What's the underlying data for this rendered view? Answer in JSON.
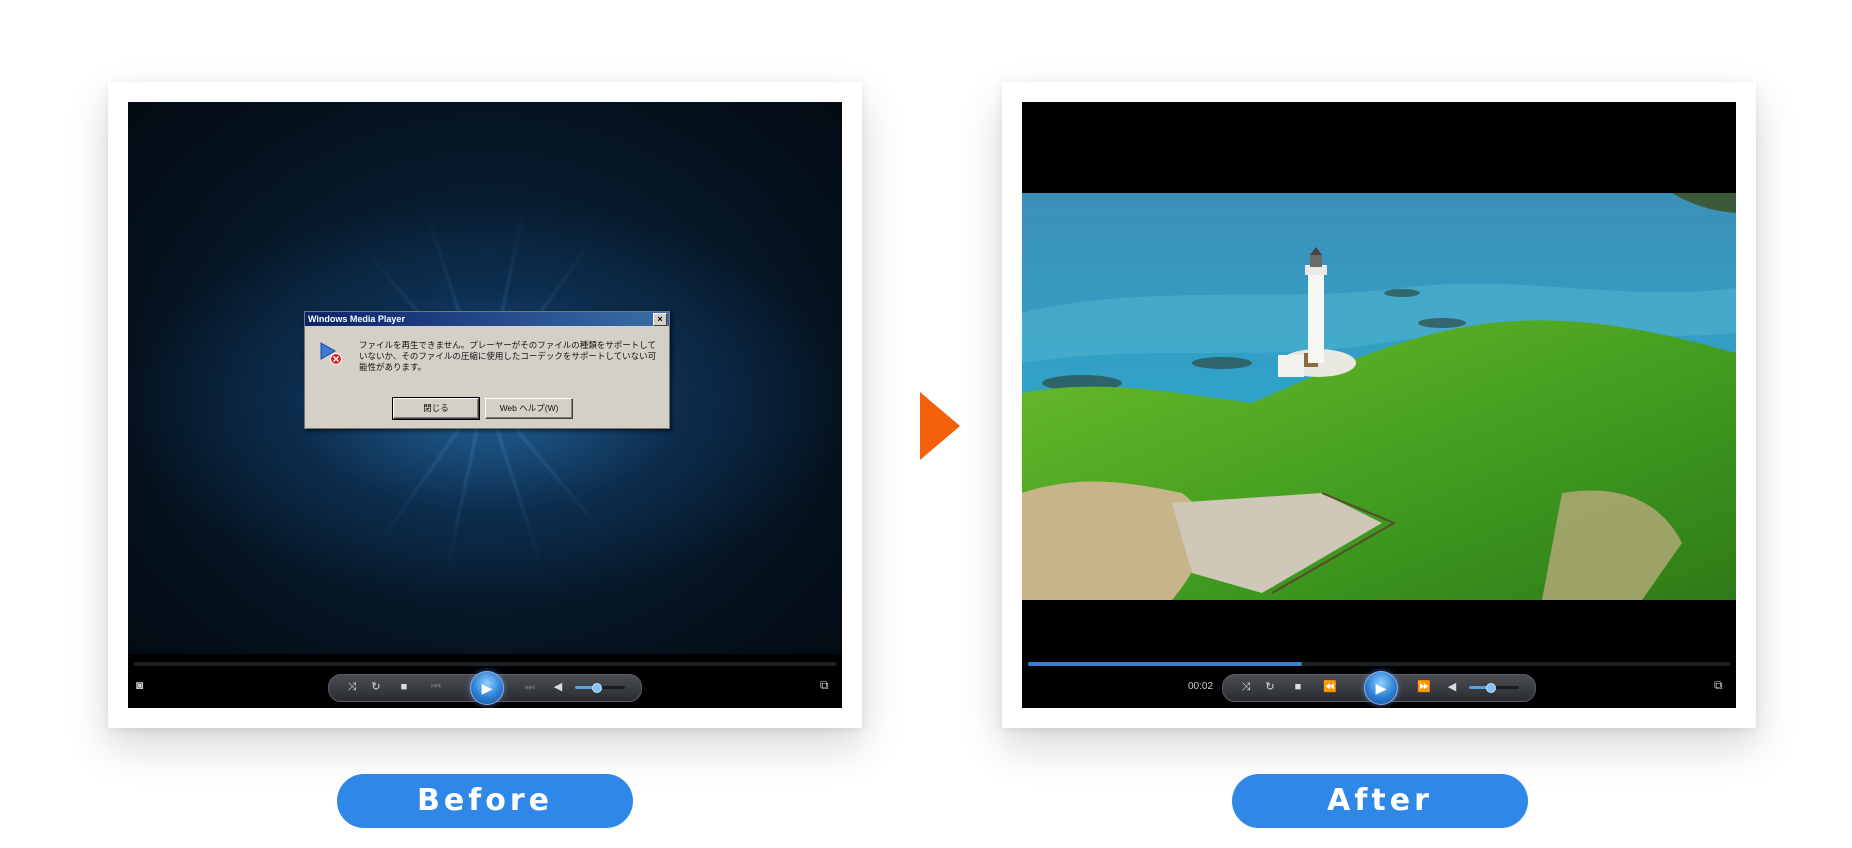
{
  "before": {
    "label": "Before",
    "dialog": {
      "title": "Windows Media Player",
      "close_glyph": "×",
      "message": "ファイルを再生できません。プレーヤーがそのファイルの種類をサポートしていないか、そのファイルの圧縮に使用したコーデックをサポートしていない可能性があります。",
      "close_button": "閉じる",
      "web_help_button": "Web ヘルプ(W)"
    },
    "seek_progress": 0
  },
  "after": {
    "label": "After",
    "time": "00:02",
    "seek_progress": 0.39
  },
  "controls": {
    "icons": [
      "shuffle-icon",
      "repeat-icon",
      "stop-icon",
      "previous-icon",
      "play-icon",
      "next-icon",
      "mute-icon",
      "volume-slider",
      "camera-icon",
      "switch-to-now-playing-icon"
    ],
    "volume_level": 0.42
  },
  "colors": {
    "accent_orange": "#f5600a",
    "label_blue": "#2f88e8",
    "seek_blue": "#3a7fd0"
  }
}
